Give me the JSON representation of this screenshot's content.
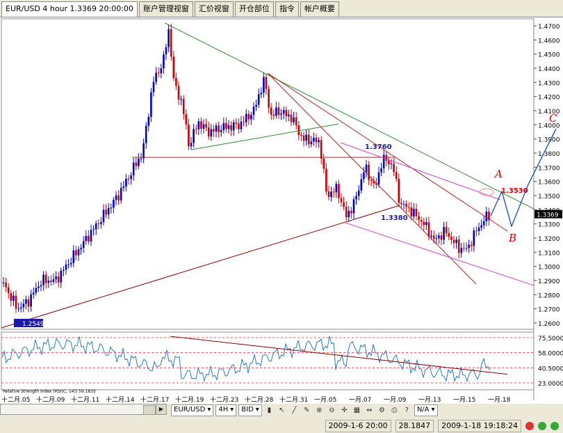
{
  "tabs": [
    {
      "label": "EUR/USD 4 hour 1.3369 20:00:00",
      "active": true
    },
    {
      "label": "账户管理视窗"
    },
    {
      "label": "汇价视窗"
    },
    {
      "label": "开仓部位"
    },
    {
      "label": "指令"
    },
    {
      "label": "帐户概要"
    }
  ],
  "chart": {
    "symbol_label": "EUR/USD 4 hour 1.3369 20:00:00",
    "price_ticks": [
      "1.4700",
      "1.4600",
      "1.4500",
      "1.4400",
      "1.4300",
      "1.4200",
      "1.4100",
      "1.4000",
      "1.3900",
      "1.3800",
      "1.3700",
      "1.3600",
      "1.3500",
      "1.3400",
      "1.3300",
      "1.3200",
      "1.3100",
      "1.3000",
      "1.2900",
      "1.2800",
      "1.2700",
      "1.2600"
    ],
    "current_price": "1.3369",
    "low_label": "1.2549",
    "annotations": {
      "a": "A",
      "b": "B",
      "c": "C",
      "p1": "1.3760",
      "p2": "1.3380",
      "p3": "1.3530"
    },
    "x_ticks": [
      "十二月.05",
      "十二月.09",
      "十二月.11",
      "十二月.14",
      "十二月.17",
      "十二月.19",
      "十二月.23",
      "十二月.28",
      "十二月.31",
      "一月.05",
      "一月.07",
      "一月.09",
      "一月.13",
      "一月.15",
      "一月.18"
    ],
    "indicator_label": "Relative Strength Index (RSI(C, 14)) 59.1835",
    "rsi_ticks": [
      "75.5000",
      "58.0000",
      "40.5000",
      "23.0000"
    ]
  },
  "toolbar": {
    "symbol": "EUR/USD",
    "timeframe": "4H",
    "side": "BID",
    "zoom": "N/A"
  },
  "status": {
    "date1": "2009-1-6  20:00",
    "value": "28.1847",
    "date2": "2009-1-18  19:18:24"
  },
  "colors": {
    "bull": "#0000cc",
    "bear": "#cc0000",
    "trend_green": "#2e8b2e",
    "trend_red": "#b22222",
    "channel_magenta": "#cc44cc",
    "annotation_red": "#dd0000",
    "annotation_blue": "#1a1aaa"
  }
}
